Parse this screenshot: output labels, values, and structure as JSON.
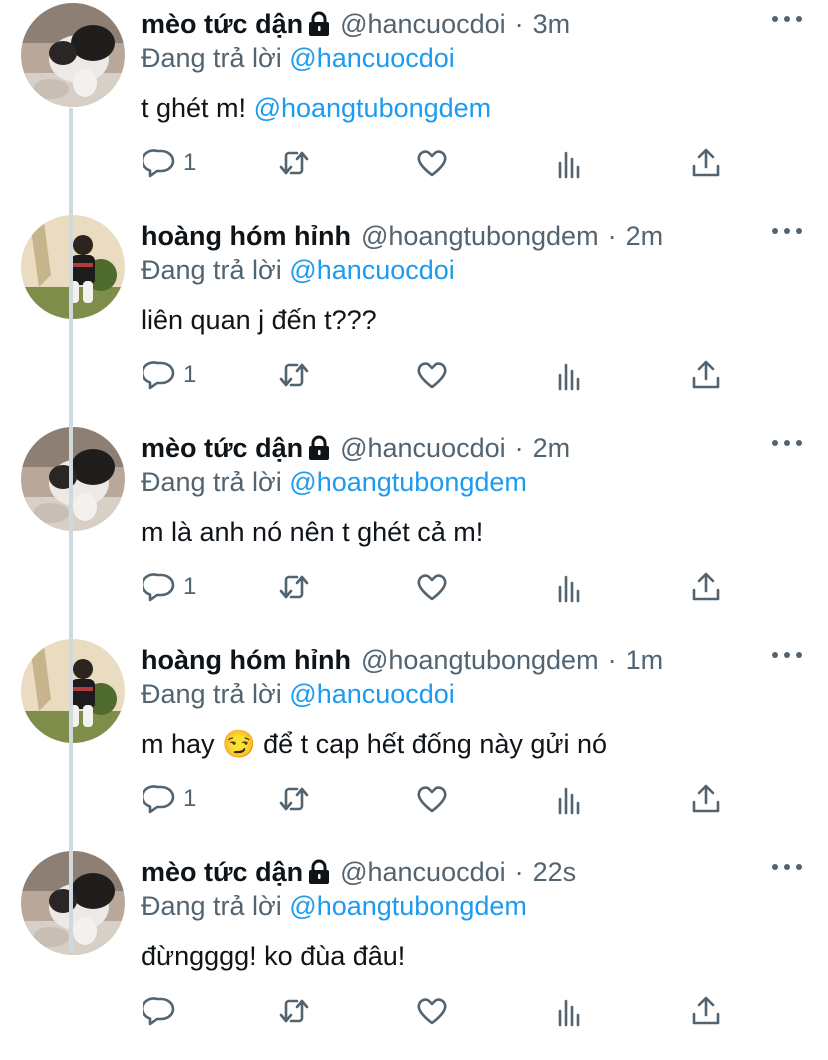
{
  "colors": {
    "text": "#0f1419",
    "secondary": "#536471",
    "mention": "#1d9bf0",
    "thread_line": "#cfd9de"
  },
  "tweets": [
    {
      "name": "mèo tức dận",
      "locked": true,
      "handle": "@hancuocdoi",
      "separator": "·",
      "time": "3m",
      "reply_prefix": "Đang trả lời",
      "reply_to": "@hancuocdoi",
      "text": "t ghét m! ",
      "text_mention": "@hoangtubongdem",
      "reply_count": "1",
      "avatar": "cat"
    },
    {
      "name": "hoàng hóm hỉnh",
      "locked": false,
      "handle": "@hoangtubongdem",
      "separator": "·",
      "time": "2m",
      "reply_prefix": "Đang trả lời",
      "reply_to": "@hancuocdoi",
      "text": "liên quan j đến t???",
      "text_mention": "",
      "reply_count": "1",
      "avatar": "person"
    },
    {
      "name": "mèo tức dận",
      "locked": true,
      "handle": "@hancuocdoi",
      "separator": "·",
      "time": "2m",
      "reply_prefix": "Đang trả lời",
      "reply_to": "@hoangtubongdem",
      "text": "m là anh nó nên t ghét cả m!",
      "text_mention": "",
      "reply_count": "1",
      "avatar": "cat"
    },
    {
      "name": "hoàng hóm hỉnh",
      "locked": false,
      "handle": "@hoangtubongdem",
      "separator": "·",
      "time": "1m",
      "reply_prefix": "Đang trả lời",
      "reply_to": "@hancuocdoi",
      "text": "m hay 😏 để t cap hết đống này gửi nó",
      "text_mention": "",
      "reply_count": "1",
      "avatar": "person"
    },
    {
      "name": "mèo tức dận",
      "locked": true,
      "handle": "@hancuocdoi",
      "separator": "·",
      "time": "22s",
      "reply_prefix": "Đang trả lời",
      "reply_to": "@hoangtubongdem",
      "text": "đừngggg! ko đùa đâu!",
      "text_mention": "",
      "reply_count": "",
      "avatar": "cat"
    }
  ],
  "icons": {
    "reply": "reply-icon",
    "retweet": "retweet-icon",
    "like": "heart-icon",
    "stats": "analytics-icon",
    "share": "share-icon",
    "more": "more-icon",
    "lock": "lock-icon"
  }
}
